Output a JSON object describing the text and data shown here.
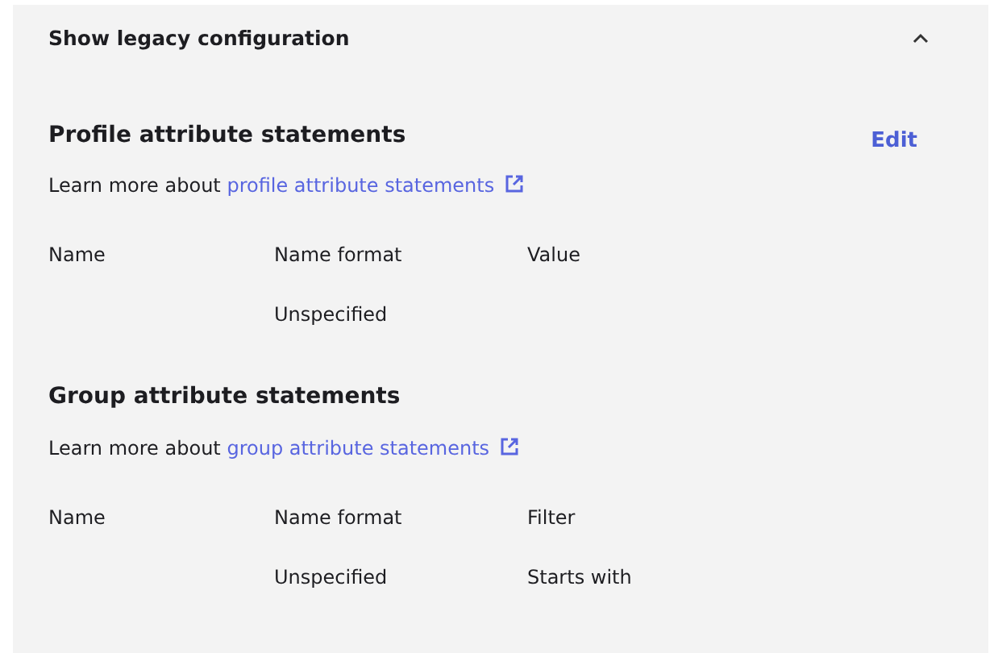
{
  "panel": {
    "title": "Show legacy configuration",
    "expanded": true
  },
  "sections": [
    {
      "title": "Profile attribute statements",
      "action": "Edit",
      "learn_prefix": "Learn more about",
      "learn_link": "profile attribute statements",
      "columns": [
        "Name",
        "Name format",
        "Value"
      ],
      "rows": [
        {
          "cells": [
            null,
            "Unspecified",
            null
          ]
        }
      ]
    },
    {
      "title": "Group attribute statements",
      "learn_prefix": "Learn more about",
      "learn_link": "group attribute statements",
      "columns": [
        "Name",
        "Name format",
        "Filter"
      ],
      "rows": [
        {
          "cells": [
            null,
            "Unspecified",
            "Starts with"
          ]
        }
      ]
    }
  ]
}
